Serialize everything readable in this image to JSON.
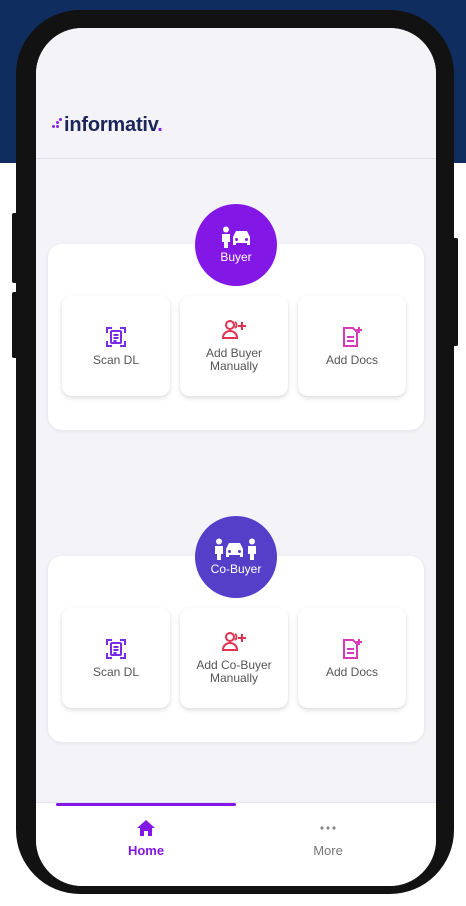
{
  "app": {
    "logo_text": "informativ",
    "logo_period": "."
  },
  "buyer_section": {
    "badge_label": "Buyer",
    "badge_icon": "person-car-icon",
    "badge_color": "#8318e6",
    "actions": [
      {
        "label": "Scan DL",
        "icon": "scan-document-icon"
      },
      {
        "label": "Add Buyer\nManually",
        "icon": "add-user-icon"
      },
      {
        "label": "Add Docs",
        "icon": "add-document-icon"
      }
    ]
  },
  "cobuyer_section": {
    "badge_label": "Co-Buyer",
    "badge_icon": "persons-car-icon",
    "badge_color": "#553fc9",
    "actions": [
      {
        "label": "Scan DL",
        "icon": "scan-document-icon"
      },
      {
        "label": "Add Co-Buyer\nManually",
        "icon": "add-user-icon"
      },
      {
        "label": "Add Docs",
        "icon": "add-document-icon"
      }
    ]
  },
  "bottom_nav": {
    "items": [
      {
        "label": "Home",
        "icon": "home-icon",
        "active": true
      },
      {
        "label": "More",
        "icon": "more-dots-icon",
        "active": false
      }
    ]
  },
  "colors": {
    "accent": "#8318e6",
    "scan_icon": "#7a2be6",
    "add_user_icon": "#e0314f",
    "add_docs_icon": "#d63ab8",
    "header_bg": "#0f2e5f"
  }
}
